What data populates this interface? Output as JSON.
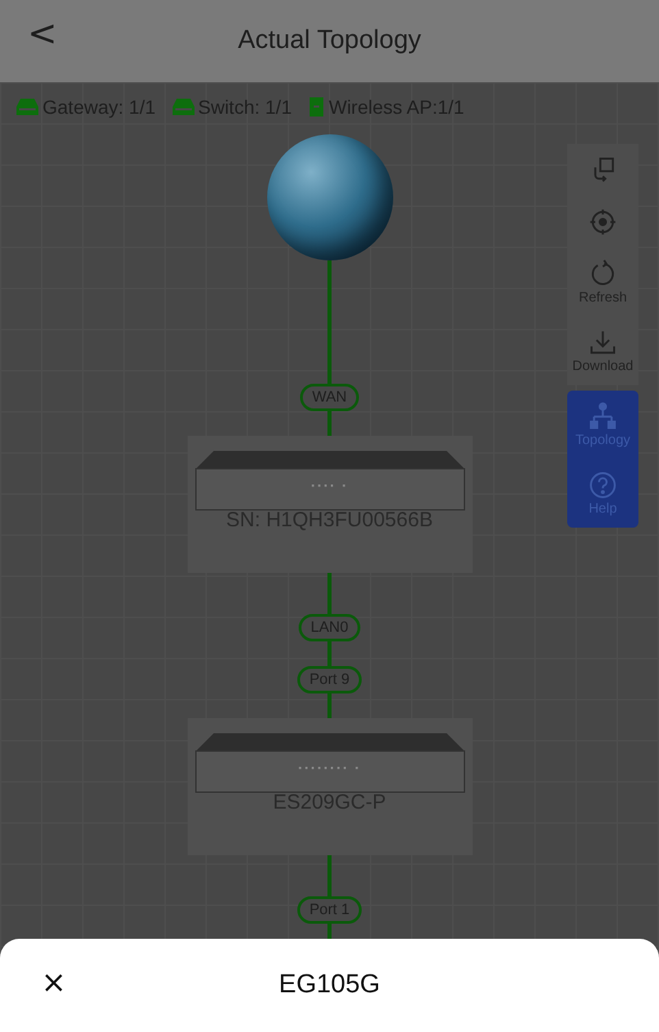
{
  "header": {
    "back": "<",
    "title": "Actual Topology"
  },
  "legend": [
    {
      "label": "Gateway: 1/1",
      "kind": "gateway"
    },
    {
      "label": "Switch: 1/1",
      "kind": "switch"
    },
    {
      "label": "Wireless AP:1/1",
      "kind": "ap"
    }
  ],
  "toolbar": [
    {
      "kind": "plain"
    },
    {
      "kind": "plain"
    },
    {
      "kind": "plain",
      "label": "Refresh"
    },
    {
      "kind": "plain",
      "label": "Download"
    },
    {
      "kind": "highlighted",
      "label": "Topology"
    },
    {
      "kind": "highlighted",
      "label": "Help"
    }
  ],
  "topology": [
    {
      "kind": "globe"
    },
    {
      "kind": "link",
      "ports": [
        "WAN"
      ]
    },
    {
      "kind": "device",
      "code": "···· ·",
      "label": "SN:  H1QH3FU00566B"
    },
    {
      "kind": "link",
      "ports": [
        "LAN0",
        "Port 9"
      ]
    },
    {
      "kind": "device",
      "code": "········ ·",
      "label": "ES209GC-P"
    },
    {
      "kind": "link",
      "ports": [
        "Port 1"
      ]
    }
  ],
  "sheet": {
    "close": "×",
    "title": "EG105G"
  }
}
